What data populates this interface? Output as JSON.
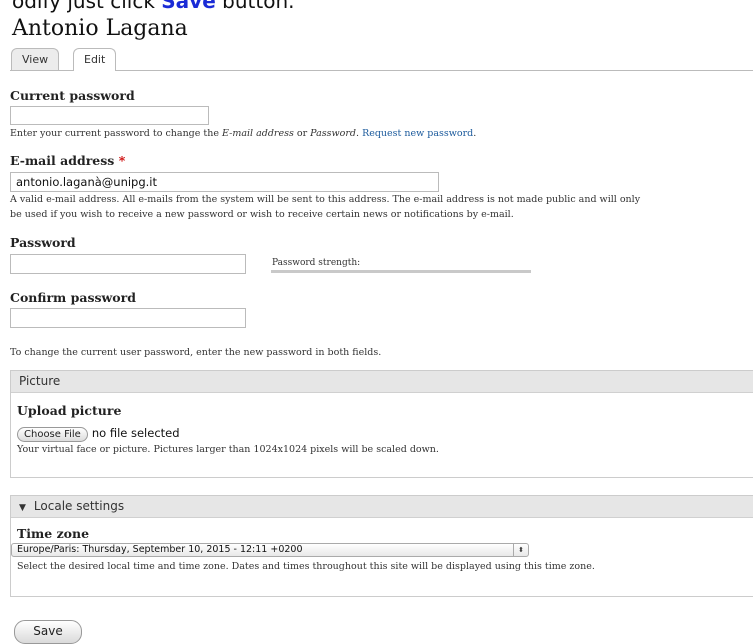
{
  "header_fragment": {
    "prefix": "odify just click ",
    "emphasis": "Save",
    "suffix": " button."
  },
  "page_title": "Antonio Lagana",
  "tabs": [
    {
      "label": "View",
      "active": false
    },
    {
      "label": "Edit",
      "active": true
    }
  ],
  "current_password": {
    "label": "Current password",
    "value": "",
    "desc_pre": "Enter your current password to change the ",
    "desc_em1": "E-mail address",
    "desc_mid": " or ",
    "desc_em2": "Password",
    "desc_post": ". ",
    "link": "Request new password",
    "desc_end": "."
  },
  "email": {
    "label": "E-mail address",
    "required_mark": "*",
    "value": "antonio.laganà@unipg.it",
    "desc_line1": "A valid e-mail address. All e-mails from the system will be sent to this address. The e-mail address is not made public and will only",
    "desc_line2": "be used if you wish to receive a new password or wish to receive certain news or notifications by e-mail."
  },
  "password": {
    "label": "Password",
    "value": "",
    "strength_label": "Password strength:"
  },
  "confirm_password": {
    "label": "Confirm password",
    "value": ""
  },
  "password_help": "To change the current user password, enter the new password in both fields.",
  "picture": {
    "legend": "Picture",
    "upload_label": "Upload picture",
    "choose_file": "Choose File",
    "no_file": "no file selected",
    "desc": "Your virtual face or picture. Pictures larger than 1024x1024 pixels will be scaled down."
  },
  "locale": {
    "legend": "Locale settings",
    "caret_icon": "caret-down-icon",
    "timezone_label": "Time zone",
    "timezone_value": "Europe/Paris: Thursday, September 10, 2015 - 12:11 +0200",
    "desc": "Select the desired local time and time zone. Dates and times throughout this site will be displayed using this time zone."
  },
  "save_label": "Save",
  "colors": {
    "link": "#1b5a9c",
    "required": "#cc0000",
    "emphasis": "#1a2bd6",
    "legend_bg": "#e6e6e6"
  }
}
